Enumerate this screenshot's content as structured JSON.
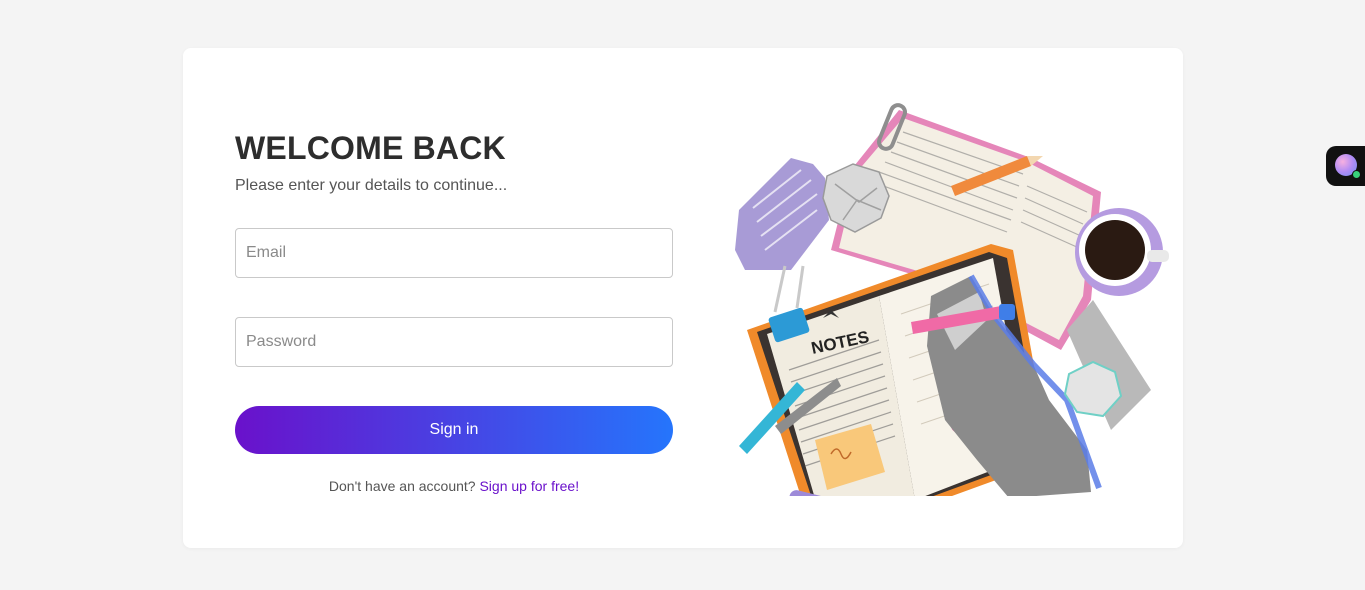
{
  "login": {
    "title": "WELCOME BACK",
    "subtitle": "Please enter your details to continue...",
    "email_placeholder": "Email",
    "password_placeholder": "Password",
    "signin_label": "Sign in",
    "signup_prompt": "Don't have an account?",
    "signup_link": "Sign up for free!"
  },
  "illustration": {
    "notes_heading": "NOTES",
    "icon": "notebook-collage-illustration"
  },
  "colors": {
    "background": "#f4f4f4",
    "card": "#ffffff",
    "button_gradient_start": "#6a11cb",
    "button_gradient_end": "#2575fc",
    "link": "#6a11cb",
    "title": "#2d2d2d"
  },
  "side_widget": {
    "icon": "assistant-avatar-icon"
  }
}
